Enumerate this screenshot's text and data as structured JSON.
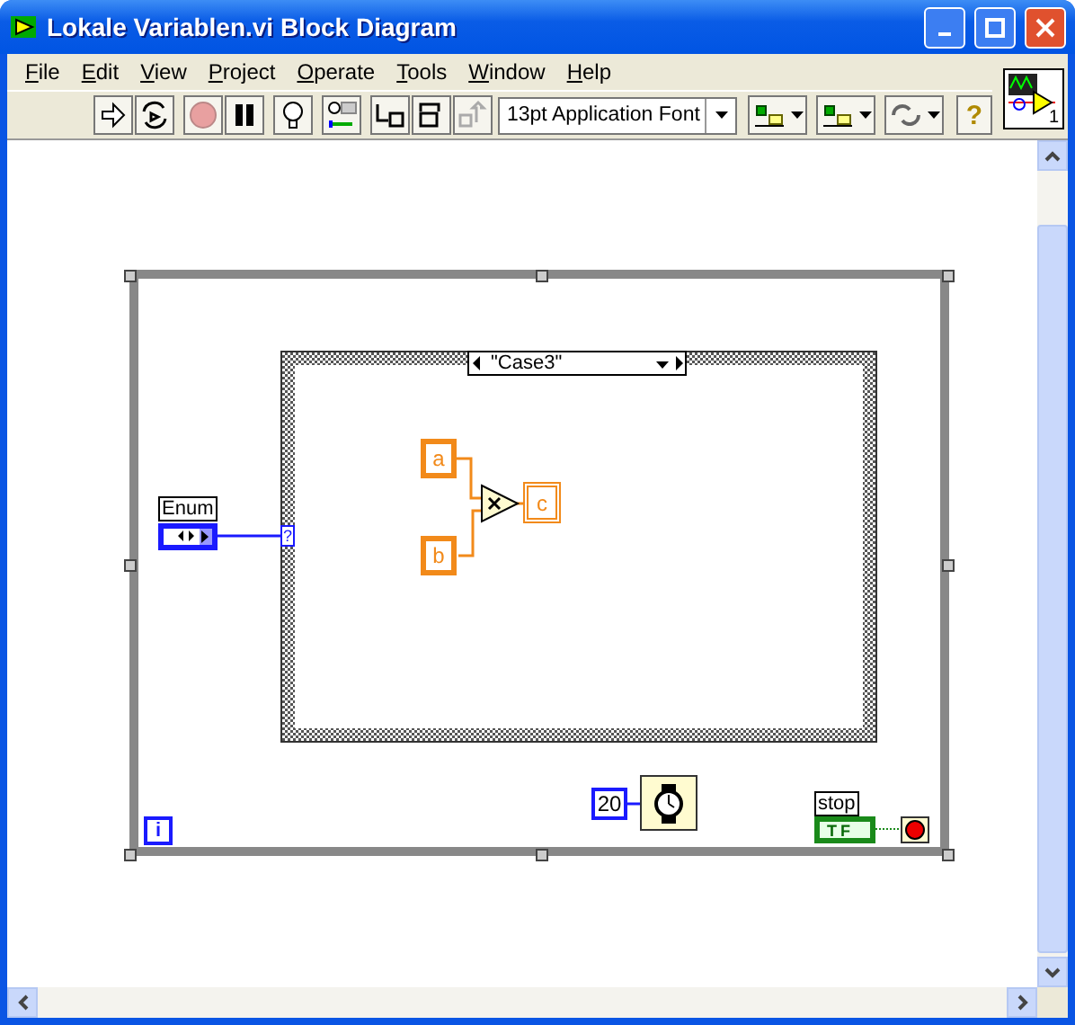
{
  "window": {
    "title": "Lokale Variablen.vi Block Diagram"
  },
  "menu": [
    "File",
    "Edit",
    "View",
    "Project",
    "Operate",
    "Tools",
    "Window",
    "Help"
  ],
  "toolbar": {
    "buttons": [
      {
        "kind": "run",
        "disabled": false
      },
      {
        "kind": "run-continuous",
        "disabled": false
      },
      {
        "kind": "abort",
        "disabled": true
      },
      {
        "kind": "pause",
        "disabled": false
      },
      {
        "kind": "highlight",
        "disabled": false
      },
      {
        "kind": "retain",
        "disabled": false
      },
      {
        "kind": "step-into",
        "disabled": false
      },
      {
        "kind": "step-over",
        "disabled": false
      },
      {
        "kind": "step-out",
        "disabled": true
      }
    ],
    "font": "13pt Application Font",
    "help": "?"
  },
  "vi_icon": {
    "number": "1"
  },
  "diagram": {
    "enum": {
      "label": "Enum"
    },
    "case": {
      "selector": "\"Case3\"",
      "tunnel": "?",
      "inputs": [
        "a",
        "b"
      ],
      "output": "c"
    },
    "wait": {
      "constant": "20"
    },
    "stop": {
      "label": "stop",
      "value": "TF"
    },
    "iteration": "i"
  }
}
